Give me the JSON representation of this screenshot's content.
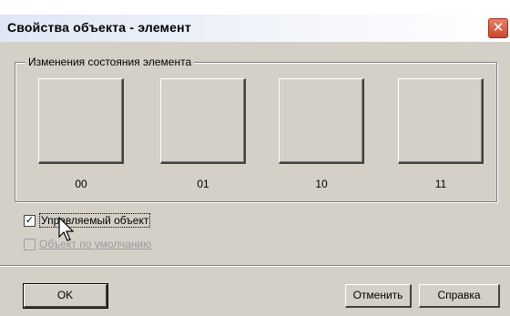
{
  "window": {
    "title": "Свойства объекта - элемент",
    "close_glyph": "✕"
  },
  "group": {
    "legend": "Изменения состояния элемента",
    "states": [
      {
        "label": "00"
      },
      {
        "label": "01"
      },
      {
        "label": "10"
      },
      {
        "label": "11"
      }
    ]
  },
  "options": {
    "controlled": {
      "label": "Управляемый объект",
      "checked": true,
      "check_glyph": "✓"
    },
    "default_object": {
      "label": "Объект по умолчанию",
      "checked": false,
      "enabled": false
    }
  },
  "buttons": {
    "ok": "OK",
    "cancel": "Отменить",
    "help": "Справка"
  },
  "colors": {
    "face": "#d4d0c8",
    "close_button": "#c8482d"
  }
}
